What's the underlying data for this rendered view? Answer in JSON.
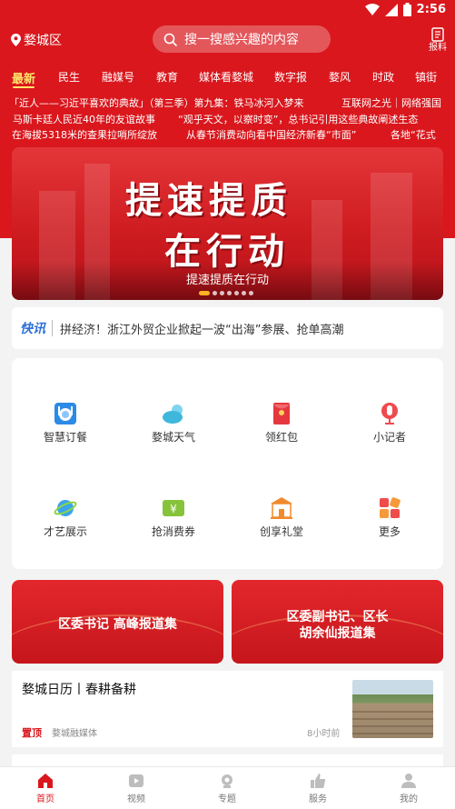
{
  "status_bar": {
    "time": "2:56"
  },
  "header": {
    "location": "婺城区",
    "search_placeholder": "搜一搜感兴趣的内容",
    "report_label": "报料"
  },
  "tabs": [
    "最新",
    "民生",
    "融媒号",
    "教育",
    "媒体看婺城",
    "数字报",
    "婺风",
    "时政",
    "镇街"
  ],
  "ticker": [
    [
      "「近人——习近平喜欢的典故」（第三季）第九集：铁马冰河入梦来",
      "互联网之光｜网络强国"
    ],
    [
      "马斯卡廷人民近40年的友谊故事",
      "“观乎天文，以察时变”，总书记引用这些典故阐述生态"
    ],
    [
      "在海拔5318米的查果拉哨所绽放",
      "从春节消费动向看中国经济新春“市面”",
      "各地“花式"
    ]
  ],
  "banner": {
    "title_line1": "提速提质",
    "title_line2": "在行动",
    "caption": "提速提质在行动",
    "slide_count": 7,
    "active_slide": 1
  },
  "flash": {
    "logo": "快讯",
    "text": "拼经济！浙江外贸企业掀起一波“出海”参展、抢单高潮"
  },
  "services": [
    {
      "label": "智慧订餐",
      "icon": "meal-icon"
    },
    {
      "label": "婺城天气",
      "icon": "weather-icon"
    },
    {
      "label": "领红包",
      "icon": "red-packet-icon"
    },
    {
      "label": "小记者",
      "icon": "microphone-icon"
    },
    {
      "label": "才艺展示",
      "icon": "planet-icon"
    },
    {
      "label": "抢消费券",
      "icon": "coupon-icon"
    },
    {
      "label": "创享礼堂",
      "icon": "hall-icon"
    },
    {
      "label": "更多",
      "icon": "more-grid-icon"
    }
  ],
  "promos": [
    {
      "lines": [
        "区委书记  高峰报道集"
      ]
    },
    {
      "lines": [
        "区委副书记、区长",
        "胡余仙报道集"
      ]
    }
  ],
  "article": {
    "title": "婺城日历丨春耕备耕",
    "pin": "置顶",
    "source": "婺城融媒体",
    "time": "8小时前"
  },
  "bottom_nav": [
    {
      "label": "首页",
      "icon": "home-icon",
      "active": true
    },
    {
      "label": "视频",
      "icon": "video-icon",
      "active": false
    },
    {
      "label": "专题",
      "icon": "topic-icon",
      "active": false
    },
    {
      "label": "服务",
      "icon": "service-icon",
      "active": false
    },
    {
      "label": "我的",
      "icon": "profile-icon",
      "active": false
    }
  ],
  "colors": {
    "brand_red": "#d9171d",
    "active_tab": "#ffe46b",
    "flash_blue": "#2d6fd8"
  }
}
